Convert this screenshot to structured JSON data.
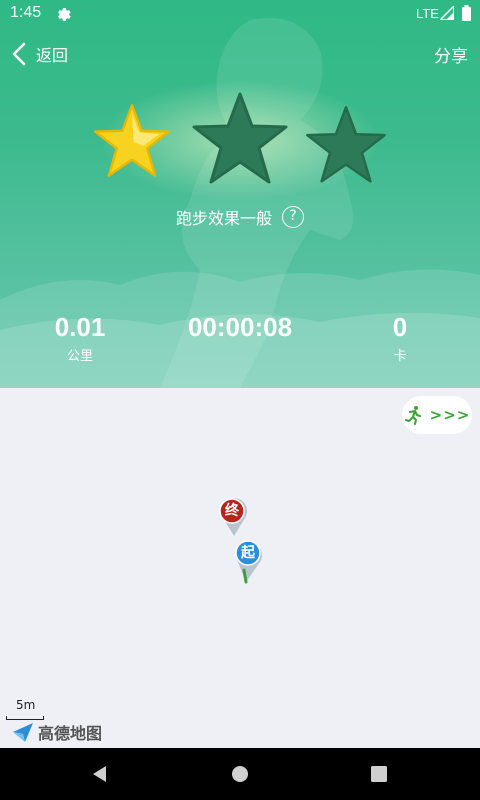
{
  "status_bar": {
    "time": "1:45",
    "network": "LTE",
    "icons": [
      "gear-icon",
      "signal-icon",
      "battery-icon"
    ]
  },
  "header": {
    "back_label": "返回",
    "share_label": "分享"
  },
  "rating": {
    "stars_filled": 1,
    "stars_total": 3,
    "effect_text": "跑步效果一般",
    "help_symbol": "?"
  },
  "stats": [
    {
      "value": "0.01",
      "unit": "公里"
    },
    {
      "value": "00:00:08",
      "unit": ""
    },
    {
      "value": "0",
      "unit": "卡"
    }
  ],
  "map": {
    "run_button_arrows": ">>>",
    "end_marker_label": "终",
    "start_marker_label": "起",
    "scale_label": "5m",
    "logo_text": "高德地图"
  },
  "colors": {
    "header_green": "#3cba8e",
    "star_gold": "#f7d21e",
    "star_dark": "#2d7a58",
    "end_marker": "#b3261e",
    "start_marker": "#2b8fd6",
    "run_arrow_green": "#3aa335"
  }
}
